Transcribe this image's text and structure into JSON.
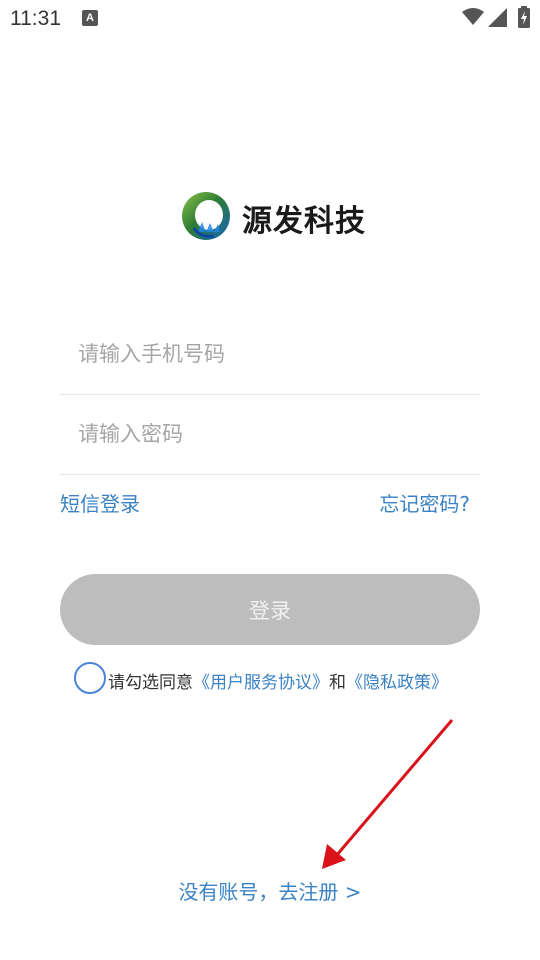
{
  "status_bar": {
    "time": "11:31",
    "notification_glyph": "A"
  },
  "brand": {
    "name": "源发科技",
    "logo_colors": [
      "#2e7d32",
      "#43a047",
      "#1e88e5",
      "#0d47a1"
    ]
  },
  "form": {
    "phone_placeholder": "请输入手机号码",
    "password_placeholder": "请输入密码"
  },
  "links": {
    "sms_login": "短信登录",
    "forgot_password": "忘记密码?"
  },
  "login_button": {
    "label": "登录"
  },
  "agreement": {
    "prefix": "请勾选同意",
    "user_agreement": "《用户服务协议》",
    "conjunction": "和",
    "privacy_policy": "《隐私政策》",
    "checked": false
  },
  "register": {
    "label": "没有账号，去注册 >"
  },
  "colors": {
    "accent": "#3b82c4",
    "button_disabled": "#bdbdbd",
    "annotation_arrow": "#d9121b"
  }
}
